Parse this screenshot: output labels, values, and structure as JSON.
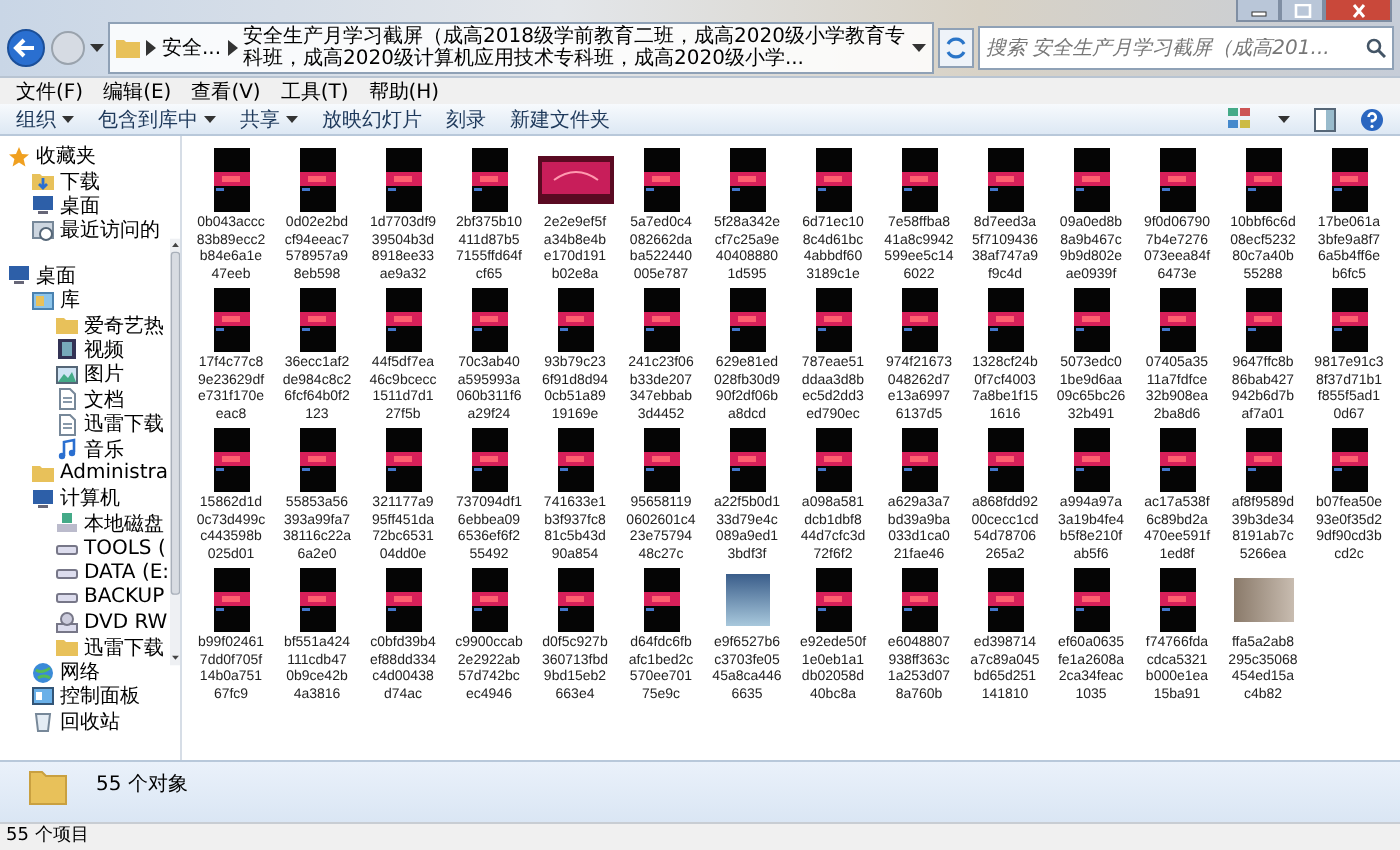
{
  "address": {
    "segments": [
      "安全...",
      "安全生产月学习截屏（成高2018级学前教育二班，成高2020级小学教育专科班，成高2020级计算机应用技术专科班，成高2020级小学..."
    ]
  },
  "search": {
    "placeholder": "搜索 安全生产月学习截屏（成高201..."
  },
  "menu": [
    "文件(F)",
    "编辑(E)",
    "查看(V)",
    "工具(T)",
    "帮助(H)"
  ],
  "toolbar": [
    {
      "label": "组织",
      "dropdown": true
    },
    {
      "label": "包含到库中",
      "dropdown": true
    },
    {
      "label": "共享",
      "dropdown": true
    },
    {
      "label": "放映幻灯片",
      "dropdown": false
    },
    {
      "label": "刻录",
      "dropdown": false
    },
    {
      "label": "新建文件夹",
      "dropdown": false
    }
  ],
  "sidebar": {
    "items": [
      {
        "label": "收藏夹",
        "kind": "favorites",
        "children": [
          {
            "label": "下载",
            "kind": "download"
          },
          {
            "label": "桌面",
            "kind": "desktop"
          },
          {
            "label": "最近访问的",
            "kind": "recent"
          }
        ]
      },
      {
        "label": "桌面",
        "kind": "desktop",
        "children": [
          {
            "label": "库",
            "kind": "library",
            "children": [
              {
                "label": "爱奇艺热",
                "kind": "folder"
              },
              {
                "label": "视频",
                "kind": "video"
              },
              {
                "label": "图片",
                "kind": "pictures"
              },
              {
                "label": "文档",
                "kind": "document"
              },
              {
                "label": "迅雷下载",
                "kind": "document"
              },
              {
                "label": "音乐",
                "kind": "music"
              }
            ]
          },
          {
            "label": "Administra",
            "kind": "folder"
          },
          {
            "label": "计算机",
            "kind": "computer",
            "children": [
              {
                "label": "本地磁盘",
                "kind": "system-drive"
              },
              {
                "label": "TOOLS (",
                "kind": "drive"
              },
              {
                "label": "DATA (E:",
                "kind": "drive"
              },
              {
                "label": "BACKUP",
                "kind": "drive"
              },
              {
                "label": "DVD RW",
                "kind": "dvd"
              },
              {
                "label": "迅雷下载",
                "kind": "folder"
              }
            ]
          },
          {
            "label": "网络",
            "kind": "network"
          },
          {
            "label": "控制面板",
            "kind": "control-panel"
          },
          {
            "label": "回收站",
            "kind": "recycle-bin"
          }
        ]
      }
    ]
  },
  "files": [
    {
      "name": [
        "0b043accc",
        "83b89ecc2",
        "b84e6a1e",
        "47eeb"
      ],
      "kind": "phone"
    },
    {
      "name": [
        "0d02e2bd",
        "cf94eeac7",
        "578957a9",
        "8eb598"
      ],
      "kind": "phone"
    },
    {
      "name": [
        "1d7703df9",
        "39504b3d",
        "8918ee33",
        "ae9a32"
      ],
      "kind": "phone"
    },
    {
      "name": [
        "2bf375b10",
        "411d87b5",
        "7155ffd64f",
        "cf65"
      ],
      "kind": "phone"
    },
    {
      "name": [
        "2e2e9ef5f",
        "a34b8e4b",
        "e170d191",
        "b02e8a"
      ],
      "kind": "banner"
    },
    {
      "name": [
        "5a7ed0c4",
        "082662da",
        "ba522440",
        "005e787"
      ],
      "kind": "phone"
    },
    {
      "name": [
        "5f28a342e",
        "cf7c25a9e",
        "40408880",
        "1d595"
      ],
      "kind": "phone"
    },
    {
      "name": [
        "6d71ec10",
        "8c4d61bc",
        "4abbdf60",
        "3189c1e"
      ],
      "kind": "phone"
    },
    {
      "name": [
        "7e58ffba8",
        "41a8c9942",
        "599ee5c14",
        "6022"
      ],
      "kind": "phone"
    },
    {
      "name": [
        "8d7eed3a",
        "5f7109436",
        "38af747a9",
        "f9c4d"
      ],
      "kind": "phone"
    },
    {
      "name": [
        "09a0ed8b",
        "8a9b467c",
        "9b9d802e",
        "ae0939f"
      ],
      "kind": "phone"
    },
    {
      "name": [
        "9f0d06790",
        "7b4e7276",
        "073eea84f",
        "6473e"
      ],
      "kind": "phone"
    },
    {
      "name": [
        "10bbf6c6d",
        "08ecf5232",
        "80c7a40b",
        "55288"
      ],
      "kind": "phone"
    },
    {
      "name": [
        "17be061a",
        "3bfe9a8f7",
        "6a5b4ff6e",
        "b6fc5"
      ],
      "kind": "phone"
    },
    {
      "name": [
        "17f4c77c8",
        "9e23629df",
        "e731f170e",
        "eac8"
      ],
      "kind": "phone"
    },
    {
      "name": [
        "36ecc1af2",
        "de984c8c2",
        "6fcf64b0f2",
        "123"
      ],
      "kind": "phone"
    },
    {
      "name": [
        "44f5df7ea",
        "46c9bcecc",
        "1511d7d1",
        "27f5b"
      ],
      "kind": "phone"
    },
    {
      "name": [
        "70c3ab40",
        "a595993a",
        "060b311f6",
        "a29f24"
      ],
      "kind": "phone"
    },
    {
      "name": [
        "93b79c23",
        "6f91d8d94",
        "0cb51a89",
        "19169e"
      ],
      "kind": "phone"
    },
    {
      "name": [
        "241c23f06",
        "b33de207",
        "347ebbab",
        "3d4452"
      ],
      "kind": "phone"
    },
    {
      "name": [
        "629e81ed",
        "028fb30d9",
        "90f2df06b",
        "a8dcd"
      ],
      "kind": "phone"
    },
    {
      "name": [
        "787eae51",
        "ddaa3d8b",
        "ec5d2dd3",
        "ed790ec"
      ],
      "kind": "phone"
    },
    {
      "name": [
        "974f21673",
        "048262d7",
        "e13a6997",
        "6137d5"
      ],
      "kind": "phone"
    },
    {
      "name": [
        "1328cf24b",
        "0f7cf4003",
        "7a8be1f15",
        "1616"
      ],
      "kind": "phone"
    },
    {
      "name": [
        "5073edc0",
        "1be9d6aa",
        "09c65bc26",
        "32b491"
      ],
      "kind": "phone"
    },
    {
      "name": [
        "07405a35",
        "11a7fdfce",
        "32b908ea",
        "2ba8d6"
      ],
      "kind": "phone"
    },
    {
      "name": [
        "9647ffc8b",
        "86bab427",
        "942b6d7b",
        "af7a01"
      ],
      "kind": "phone"
    },
    {
      "name": [
        "9817e91c3",
        "8f37d71b1",
        "f855f5ad1",
        "0d67"
      ],
      "kind": "phone"
    },
    {
      "name": [
        "15862d1d",
        "0c73d499c",
        "c443598b",
        "025d01"
      ],
      "kind": "phone"
    },
    {
      "name": [
        "55853a56",
        "393a99fa7",
        "38116c22a",
        "6a2e0"
      ],
      "kind": "phone"
    },
    {
      "name": [
        "321177a9",
        "95ff451da",
        "72bc6531",
        "04dd0e"
      ],
      "kind": "phone"
    },
    {
      "name": [
        "737094df1",
        "6ebbea09",
        "6536ef6f2",
        "55492"
      ],
      "kind": "phone"
    },
    {
      "name": [
        "741633e1",
        "b3f937fc8",
        "81c5b43d",
        "90a854"
      ],
      "kind": "phone"
    },
    {
      "name": [
        "95658119",
        "0602601c4",
        "23e75794",
        "48c27c"
      ],
      "kind": "phone"
    },
    {
      "name": [
        "a22f5b0d1",
        "33d79e4c",
        "089a9ed1",
        "3bdf3f"
      ],
      "kind": "phone"
    },
    {
      "name": [
        "a098a581",
        "dcb1dbf8",
        "44d7cfc3d",
        "72f6f2"
      ],
      "kind": "phone"
    },
    {
      "name": [
        "a629a3a7",
        "bd39a9ba",
        "033d1ca0",
        "21fae46"
      ],
      "kind": "phone"
    },
    {
      "name": [
        "a868fdd92",
        "00cecc1cd",
        "54d78706",
        "265a2"
      ],
      "kind": "phone"
    },
    {
      "name": [
        "a994a97a",
        "3a19b4fe4",
        "b5f8e210f",
        "ab5f6"
      ],
      "kind": "phone"
    },
    {
      "name": [
        "ac17a538f",
        "6c89bd2a",
        "470ee591f",
        "1ed8f"
      ],
      "kind": "phone"
    },
    {
      "name": [
        "af8f9589d",
        "39b3de34",
        "8191ab7c",
        "5266ea"
      ],
      "kind": "phone"
    },
    {
      "name": [
        "b07fea50e",
        "93e0f35d2",
        "9df90cd3b",
        "cd2c"
      ],
      "kind": "phone"
    },
    {
      "name": [
        "b99f02461",
        "7dd0f705f",
        "14b0a751",
        "67fc9"
      ],
      "kind": "phone"
    },
    {
      "name": [
        "bf551a424",
        "111cdb47",
        "0b9ce42b",
        "4a3816"
      ],
      "kind": "phone"
    },
    {
      "name": [
        "c0bfd39b4",
        "ef88dd334",
        "c4d00438",
        "d74ac"
      ],
      "kind": "phone"
    },
    {
      "name": [
        "c9900ccab",
        "2e2922ab",
        "57d742bc",
        "ec4946"
      ],
      "kind": "phone"
    },
    {
      "name": [
        "d0f5c927b",
        "360713fbd",
        "9bd15eb2",
        "663e4"
      ],
      "kind": "phone"
    },
    {
      "name": [
        "d64fdc6fb",
        "afc1bed2c",
        "570ee701",
        "75e9c"
      ],
      "kind": "phone"
    },
    {
      "name": [
        "e9f6527b6",
        "c3703fe05",
        "45a8ca446",
        "6635"
      ],
      "kind": "photo-square"
    },
    {
      "name": [
        "e92ede50f",
        "1e0eb1a1",
        "db02058d",
        "40bc8a"
      ],
      "kind": "phone"
    },
    {
      "name": [
        "e6048807",
        "938ff363c",
        "1a253d07",
        "8a760b"
      ],
      "kind": "phone"
    },
    {
      "name": [
        "ed398714",
        "a7c89a045",
        "bd65d251",
        "141810"
      ],
      "kind": "phone"
    },
    {
      "name": [
        "ef60a0635",
        "fe1a2608a",
        "2ca34feac",
        "1035"
      ],
      "kind": "phone"
    },
    {
      "name": [
        "f74766fda",
        "cdca5321",
        "b000e1ea",
        "15ba91"
      ],
      "kind": "phone"
    },
    {
      "name": [
        "ffa5a2ab8",
        "295c35068",
        "454ed15a",
        "c4b82"
      ],
      "kind": "photo-wide"
    }
  ],
  "details": {
    "summary": "55 个对象"
  },
  "status_bar": {
    "text": "55 个项目"
  }
}
